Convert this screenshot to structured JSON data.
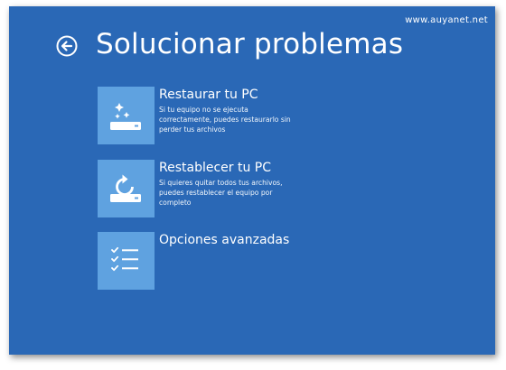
{
  "watermark": "www.auyanet.net",
  "header": {
    "back_icon": "back-arrow-circle-icon",
    "title": "Solucionar problemas"
  },
  "colors": {
    "background": "#2a68b6",
    "tile": "#5fa2e0",
    "text": "#ffffff"
  },
  "options": [
    {
      "icon": "refresh-drive-sparkle-icon",
      "title": "Restaurar tu PC",
      "desc_lines": [
        "Si tu equipo no se ejecuta",
        "correctamente, puedes restaurarlo sin",
        "perder tus archivos"
      ]
    },
    {
      "icon": "reset-drive-circular-arrow-icon",
      "title": "Restablecer tu PC",
      "desc_lines": [
        "Si quieres quitar todos tus archivos,",
        "puedes restablecer el equipo por",
        "completo"
      ]
    },
    {
      "icon": "checklist-icon",
      "title": "Opciones avanzadas",
      "desc_lines": []
    }
  ]
}
